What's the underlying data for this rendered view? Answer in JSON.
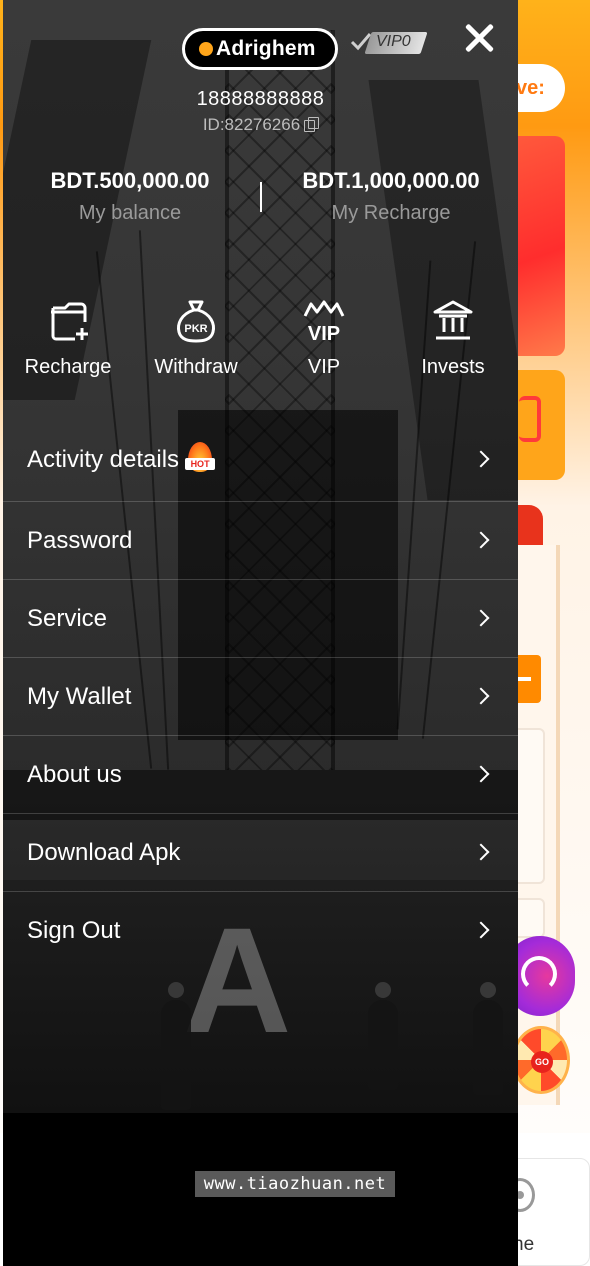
{
  "drawer": {
    "logo_text": "Adrighem",
    "vip_level": "VIP0",
    "phone": "18888888888",
    "user_id": "ID:82276266",
    "balance": {
      "value": "BDT.500,000.00",
      "label": "My balance"
    },
    "recharge_total": {
      "value": "BDT.1,000,000.00",
      "label": "My Recharge"
    },
    "actions": [
      {
        "label": "Recharge",
        "icon": "recharge-icon"
      },
      {
        "label": "Withdraw",
        "icon": "pkr-bag-icon"
      },
      {
        "label": "VIP",
        "icon": "vip-crown-icon"
      },
      {
        "label": "Invests",
        "icon": "bank-icon"
      }
    ],
    "menu": [
      {
        "label": "Activity details",
        "badge": "HOT"
      },
      {
        "label": "Password"
      },
      {
        "label": "Service"
      },
      {
        "label": "My Wallet"
      },
      {
        "label": "About us"
      },
      {
        "label": "Download Apk"
      },
      {
        "label": "Sign Out"
      }
    ]
  },
  "background_app": {
    "pill_text": "ve:",
    "bottom_nav_label": "ne",
    "colors": {
      "accent": "#ff9a12",
      "service": "#a42bd9"
    }
  },
  "watermark": "www.tiaozhuan.net"
}
